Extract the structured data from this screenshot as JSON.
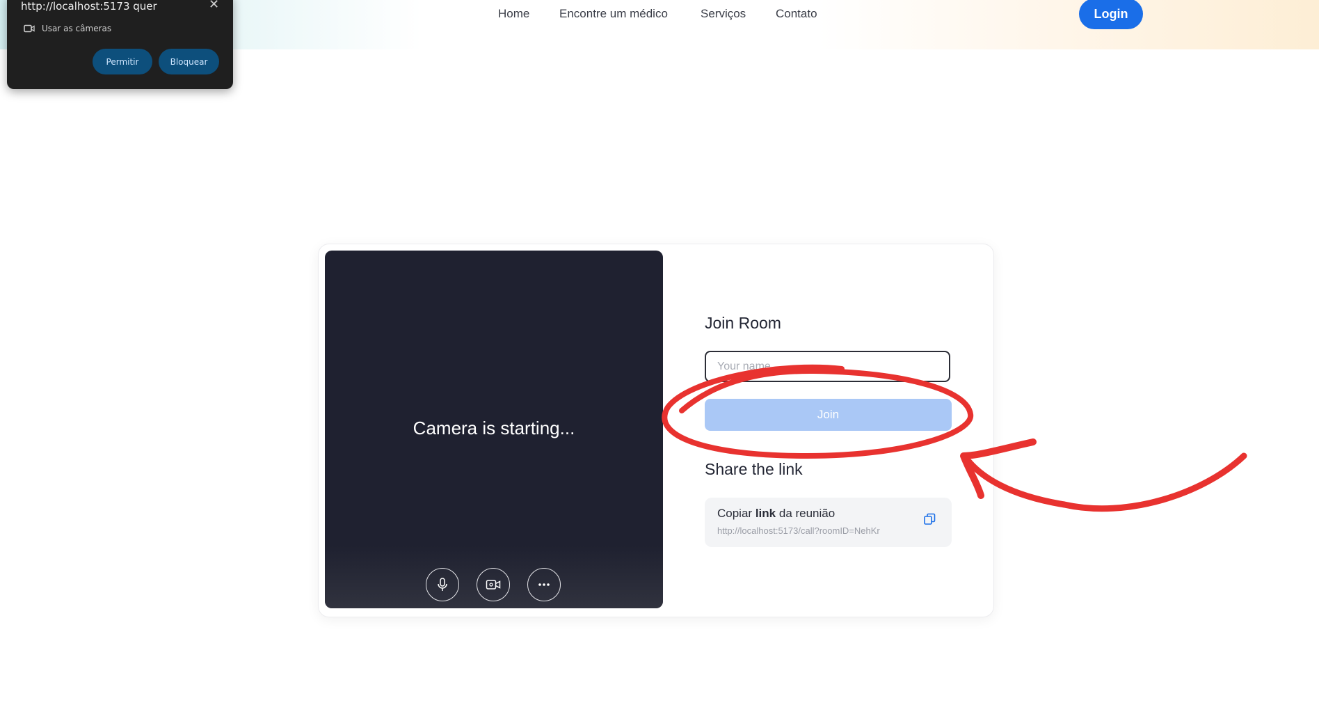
{
  "nav": {
    "links": [
      "Home",
      "Encontre um médico",
      "Serviços",
      "Contato"
    ],
    "login_label": "Login"
  },
  "permission_popup": {
    "title": "http://localhost:5173 quer",
    "close_icon": "close-icon",
    "request_label": "Usar as câmeras",
    "request_icon": "camera-icon",
    "allow_label": "Permitir",
    "block_label": "Bloquear"
  },
  "video_panel": {
    "status_text": "Camera is starting...",
    "controls": [
      "microphone-icon",
      "video-camera-icon",
      "more-options-icon"
    ]
  },
  "join": {
    "heading": "Join Room",
    "name_placeholder": "Your name",
    "name_value": "",
    "button_label": "Join"
  },
  "share": {
    "heading": "Share the link",
    "copy_prefix": "Copiar",
    "copy_bold": "link",
    "copy_suffix": "da reunião",
    "url": "http://localhost:5173/call?roomID=NehKr",
    "copy_icon": "copy-icon"
  },
  "colors": {
    "primary": "#1a6ee8",
    "join_button": "#aac8f6",
    "video_bg": "#1f2130",
    "annotation": "#e8322f",
    "popup_bg": "#1f1f1f",
    "popup_button": "#0d4f7c"
  }
}
